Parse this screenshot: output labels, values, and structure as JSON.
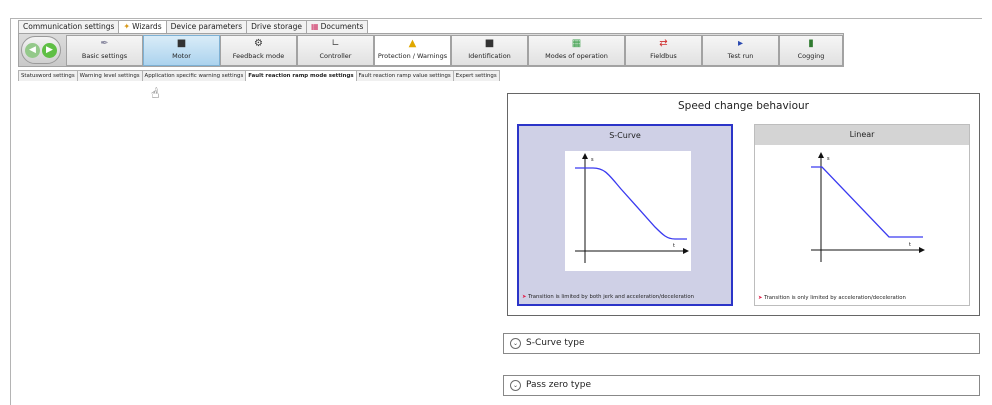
{
  "top_tabs": [
    {
      "label": "Communication settings",
      "icon": "none"
    },
    {
      "label": "Wizards",
      "icon": "wand-icon"
    },
    {
      "label": "Device parameters",
      "icon": "none"
    },
    {
      "label": "Drive storage",
      "icon": "none"
    },
    {
      "label": "Documents",
      "icon": "documents-icon"
    }
  ],
  "wizard_steps": [
    {
      "label": "Basic settings",
      "icon": "wrench-icon"
    },
    {
      "label": "Motor",
      "icon": "motor-icon"
    },
    {
      "label": "Feedback mode",
      "icon": "encoder-icon"
    },
    {
      "label": "Controller",
      "icon": "controller-icon"
    },
    {
      "label": "Protection / Warnings",
      "icon": "warning-icon"
    },
    {
      "label": "Identification",
      "icon": "identification-icon"
    },
    {
      "label": "Modes of operation",
      "icon": "modes-icon"
    },
    {
      "label": "Fieldbus",
      "icon": "fieldbus-icon"
    },
    {
      "label": "Test run",
      "icon": "play-icon"
    },
    {
      "label": "Cogging",
      "icon": "cogging-icon"
    }
  ],
  "sub_tabs": [
    "Statusword settings",
    "Warning level settings",
    "Application specific warning settings",
    "Fault reaction ramp mode settings",
    "Fault reaction ramp value settings",
    "Expert settings"
  ],
  "speed_panel": {
    "title": "Speed change behaviour",
    "scurve": {
      "title": "S-Curve",
      "y_axis": "s",
      "x_axis": "t",
      "note": "Transition is limited by both jerk and acceleration/deceleration"
    },
    "linear": {
      "title": "Linear",
      "y_axis": "s",
      "x_axis": "t",
      "note": "Transition is only limited by acceleration/deceleration"
    }
  },
  "sections": {
    "scurve_type": "S-Curve type",
    "pass_zero_type": "Pass zero type"
  },
  "colors": {
    "selected_border": "#2b34c8",
    "curve": "#3a3af0",
    "note_marker": "#e0204a"
  }
}
